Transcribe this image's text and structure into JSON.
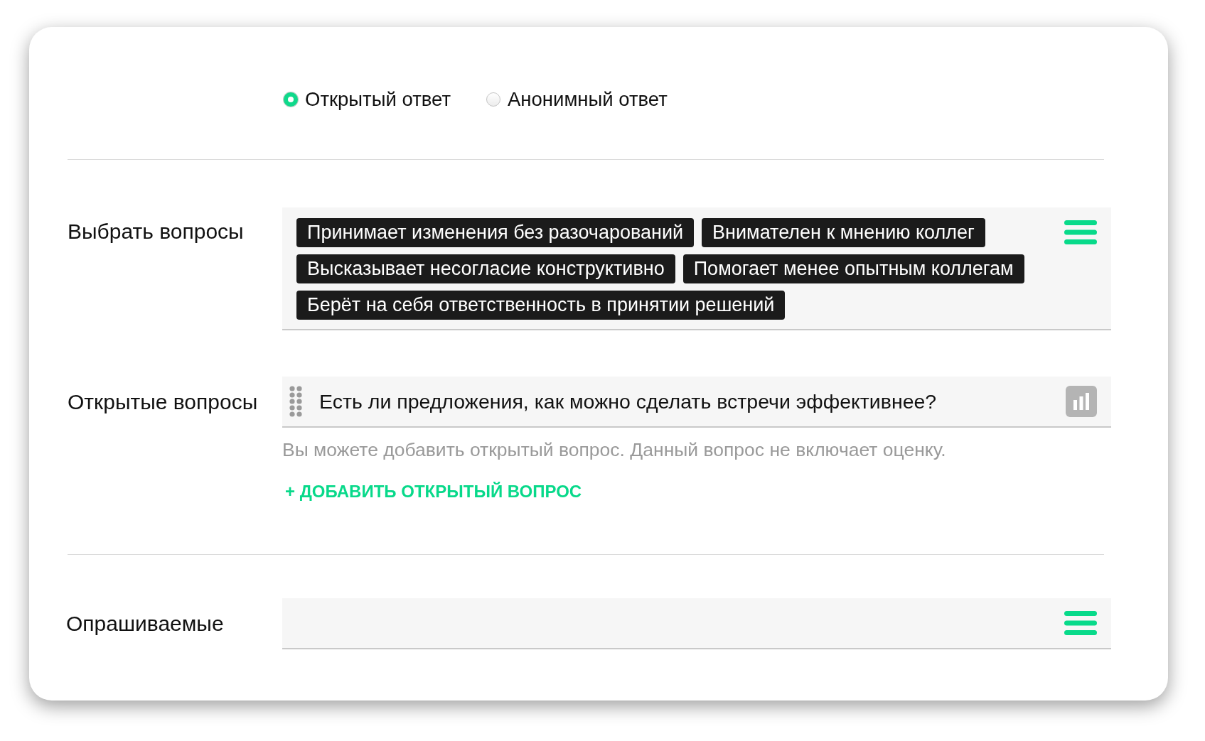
{
  "response_type": {
    "options": [
      {
        "label": "Открытый ответ",
        "selected": true
      },
      {
        "label": "Анонимный ответ",
        "selected": false
      }
    ]
  },
  "select_questions": {
    "label": "Выбрать вопросы",
    "tags": [
      "Принимает изменения без разочарований",
      "Внимателен к мнению коллег",
      "Высказывает несогласие конструктивно",
      "Помогает менее опытным коллегам",
      "Берёт на себя ответственность в принятии решений"
    ]
  },
  "open_questions": {
    "label": "Открытые вопросы",
    "items": [
      {
        "text": "Есть ли предложения, как можно сделать встречи эффективнее?"
      }
    ],
    "hint": "Вы можете добавить открытый вопрос. Данный вопрос не включает оценку.",
    "add_link": "+ ДОБАВИТЬ ОТКРЫТЫЙ ВОПРОС"
  },
  "respondents": {
    "label": "Опрашиваемые"
  }
}
